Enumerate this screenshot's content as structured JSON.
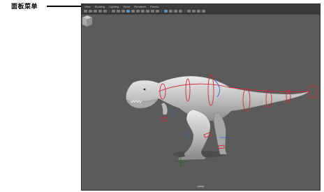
{
  "callout": {
    "label": "面板菜单"
  },
  "menu": {
    "items": [
      "View",
      "Shading",
      "Lighting",
      "Show",
      "Renderer",
      "Panels"
    ]
  },
  "viewport": {
    "camera_name": "persp"
  },
  "colors": {
    "panel_bg": "#444444",
    "viewport_bg": "#5b5b5b",
    "rig_control": "#cc2a3c",
    "model": "#d0d0d0"
  }
}
